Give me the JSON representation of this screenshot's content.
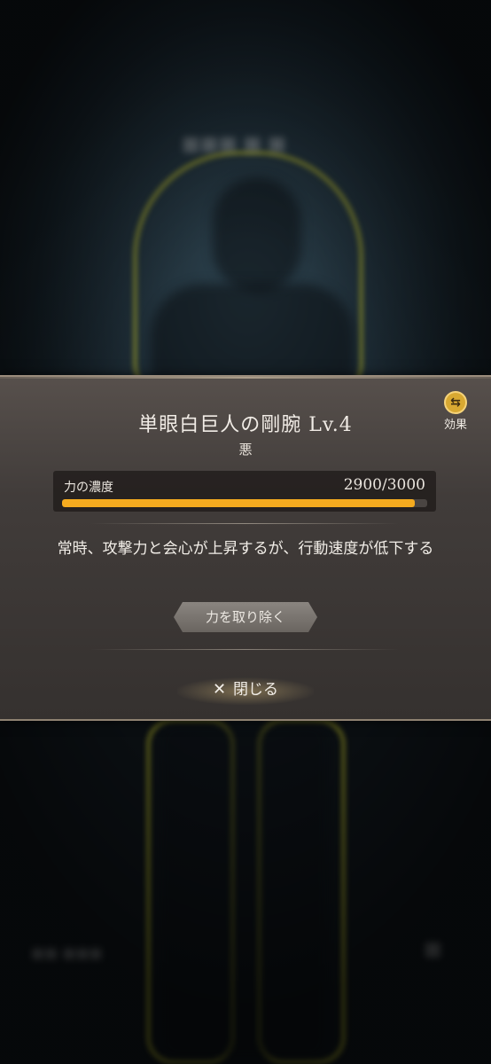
{
  "dialog": {
    "title": "単眼白巨人の剛腕 Lv.4",
    "attribute": "悪",
    "effect_button": {
      "icon": "swap-icon",
      "label": "効果"
    },
    "gauge": {
      "label": "力の濃度",
      "value_text": "2900/3000",
      "current": 2900,
      "max": 3000,
      "fill_color": "#f5ab1f"
    },
    "description": "常時、攻撃力と会心が上昇するが、行動速度が低下する",
    "remove_button_label": "力を取り除く",
    "close_button": {
      "icon": "close-icon",
      "label": "閉じる"
    }
  }
}
